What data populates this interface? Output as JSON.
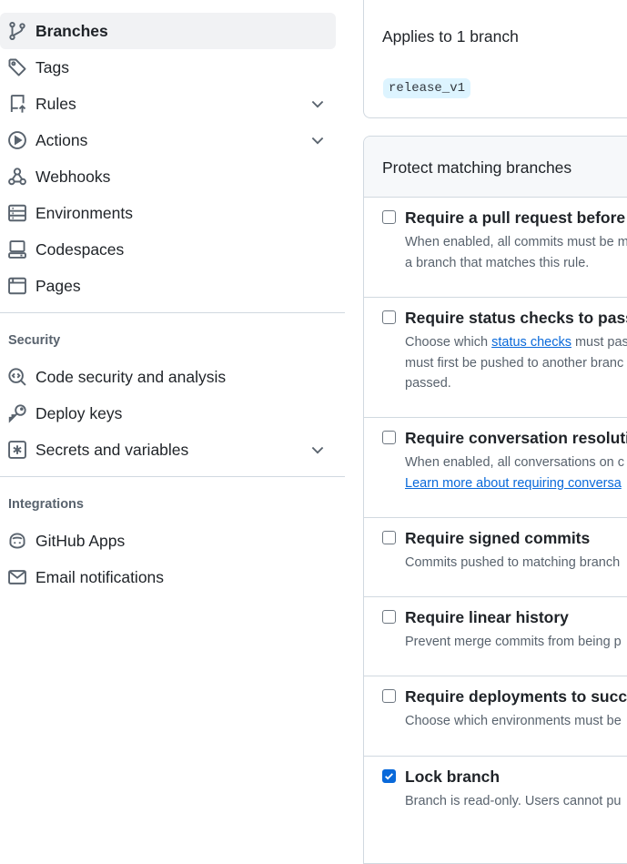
{
  "sidebar": {
    "items": [
      {
        "label": "Branches",
        "icon": "git-branch-icon",
        "active": true
      },
      {
        "label": "Tags",
        "icon": "tag-icon"
      },
      {
        "label": "Rules",
        "icon": "repo-push-icon",
        "expandable": true
      },
      {
        "label": "Actions",
        "icon": "play-icon",
        "expandable": true
      },
      {
        "label": "Webhooks",
        "icon": "webhook-icon"
      },
      {
        "label": "Environments",
        "icon": "server-icon"
      },
      {
        "label": "Codespaces",
        "icon": "codespaces-icon"
      },
      {
        "label": "Pages",
        "icon": "browser-icon"
      }
    ],
    "security": {
      "heading": "Security",
      "items": [
        {
          "label": "Code security and analysis",
          "icon": "codescan-icon"
        },
        {
          "label": "Deploy keys",
          "icon": "key-icon"
        },
        {
          "label": "Secrets and variables",
          "icon": "key-asterisk-icon",
          "expandable": true
        }
      ]
    },
    "integrations": {
      "heading": "Integrations",
      "items": [
        {
          "label": "GitHub Apps",
          "icon": "copilot-icon"
        },
        {
          "label": "Email notifications",
          "icon": "mail-icon"
        }
      ]
    }
  },
  "applies": {
    "title": "Applies to 1 branch",
    "branch": "release_v1"
  },
  "protect": {
    "title": "Protect matching branches",
    "rules": [
      {
        "title": "Require a pull request before m",
        "desc_lines": [
          "When enabled, all commits must be m",
          "a branch that matches this rule."
        ],
        "checked": false
      },
      {
        "title": "Require status checks to pass b",
        "desc_pre": "Choose which ",
        "desc_link": "status checks",
        "desc_post": " must pas",
        "desc_lines": [
          "must first be pushed to another branc",
          "passed."
        ],
        "checked": false
      },
      {
        "title": "Require conversation resolution",
        "desc_lines": [
          "When enabled, all conversations on c"
        ],
        "desc_link_line": "Learn more about requiring conversa",
        "checked": false
      },
      {
        "title": "Require signed commits",
        "desc_lines": [
          "Commits pushed to matching branch"
        ],
        "checked": false
      },
      {
        "title": "Require linear history",
        "desc_lines": [
          "Prevent merge commits from being p"
        ],
        "checked": false
      },
      {
        "title": "Require deployments to succee",
        "desc_lines": [
          "Choose which environments must be"
        ],
        "checked": false
      },
      {
        "title": "Lock branch",
        "desc_lines": [
          "Branch is read-only. Users cannot pu"
        ],
        "checked": true
      }
    ]
  },
  "colors": {
    "accent": "#0969da",
    "muted": "#59636e",
    "border": "#d1d9e0",
    "active_bg": "#f1f2f4"
  }
}
